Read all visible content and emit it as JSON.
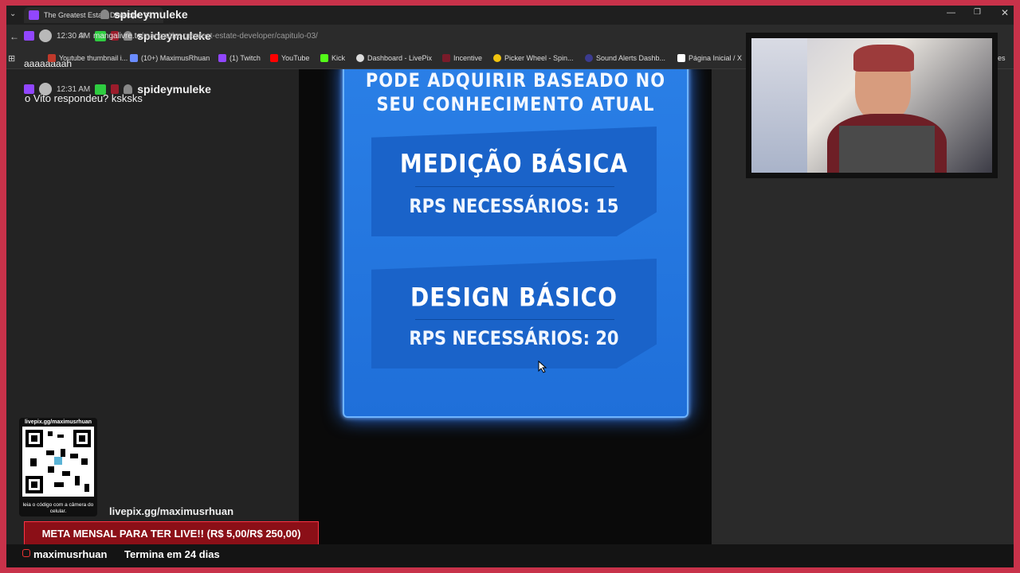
{
  "browser": {
    "tab_title": "The Greatest Estate Developer",
    "url_host": "mangalivre.to",
    "url_path": "/manga/the-greatest-estate-developer/capitulo-03/",
    "bookmarks": [
      {
        "label": "Youtube thumbnail i...",
        "color": "#c0392b"
      },
      {
        "label": "(10+) MaximusRhuan",
        "color": "#6a8cff"
      },
      {
        "label": "(1) Twitch",
        "color": "#9146ff"
      },
      {
        "label": "YouTube",
        "color": "#ff0000"
      },
      {
        "label": "Kick",
        "color": "#53fc18"
      },
      {
        "label": "Dashboard - LivePix",
        "color": "#dddddd"
      },
      {
        "label": "Incentive",
        "color": "#7a1b2a"
      },
      {
        "label": "Picker Wheel - Spin...",
        "color": "#f1c40f"
      },
      {
        "label": "Sound Alerts Dashb...",
        "color": "#3b3b8f"
      },
      {
        "label": "Página Inicial / X",
        "color": "#ffffff"
      }
    ],
    "bookmarks_more": "ores"
  },
  "chat": {
    "messages": [
      {
        "time": "12:30 AM",
        "user": "spideymuleke",
        "text": "aaaaaaaah"
      },
      {
        "time": "12:31 AM",
        "user": "spideymuleke",
        "text": "o Vito respondeu? ksksks"
      }
    ],
    "top_user": "spideymuleke"
  },
  "manga": {
    "header_line1": "PODE ADQUIRIR BASEADO NO",
    "header_line2": "SEU CONHECIMENTO ATUAL",
    "skills": [
      {
        "name": "MEDIÇÃO BÁSICA",
        "req": "RPS NECESSÁRIOS: 15"
      },
      {
        "name": "DESIGN BÁSICO",
        "req": "RPS NECESSÁRIOS: 20"
      }
    ]
  },
  "overlay": {
    "qr_url": "livepix.gg/maximusrhuan",
    "qr_caption": "leia o código com a câmera do celular.",
    "livepix_link": "livepix.gg/maximusrhuan",
    "goal_text": "META MENSAL PARA TER LIVE!! (R$ 5,00/R$ 250,00)",
    "instagram": "maximusrhuan",
    "ends_in": "Termina em 24 dias"
  }
}
